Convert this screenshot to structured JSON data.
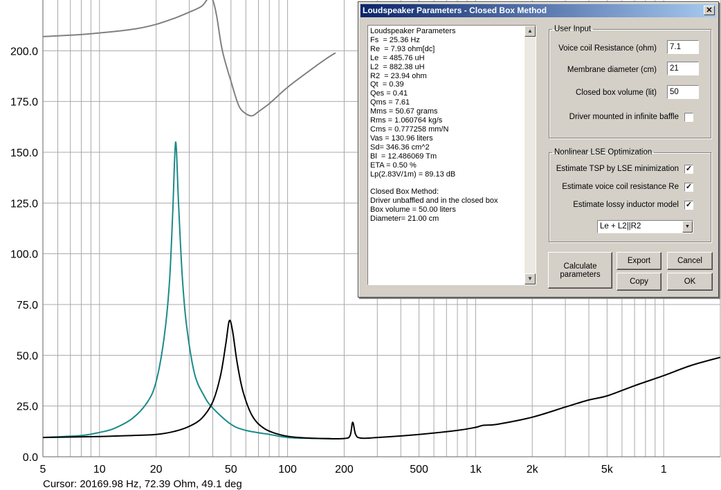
{
  "chart_data": {
    "type": "line",
    "xscale": "log",
    "xlim": [
      5,
      20000
    ],
    "ylim": [
      0,
      225
    ],
    "y_ticks": [
      "0.0",
      "25.0",
      "50.0",
      "75.0",
      "100.0",
      "125.0",
      "150.0",
      "175.0",
      "200.0"
    ],
    "y_tick_values": [
      0,
      25,
      50,
      75,
      100,
      125,
      150,
      175,
      200
    ],
    "x_ticks": [
      "5",
      "10",
      "20",
      "50",
      "100",
      "200",
      "500",
      "1k",
      "2k",
      "5k",
      "1"
    ],
    "x_tick_values": [
      5,
      10,
      20,
      50,
      100,
      200,
      500,
      1000,
      2000,
      5000,
      10000
    ],
    "grid": true,
    "series": [
      {
        "color": "#808080",
        "x": [
          5,
          8,
          12,
          16,
          20,
          25,
          30,
          35,
          38,
          40,
          42,
          45,
          50,
          55,
          60,
          65,
          70,
          80,
          100,
          130,
          160,
          180
        ],
        "y": [
          207,
          208,
          209.5,
          211,
          213,
          216,
          219,
          222,
          226,
          225,
          217,
          200,
          185,
          173,
          169,
          168,
          170,
          174,
          182,
          190,
          196,
          199
        ]
      },
      {
        "color": "#1a8a8a",
        "x": [
          5,
          8,
          10,
          12,
          15,
          18,
          20,
          22,
          23.5,
          24.5,
          25.4,
          26.3,
          27.5,
          29,
          32,
          36,
          40,
          50,
          60,
          80,
          100,
          130,
          170
        ],
        "y": [
          9.5,
          10.5,
          12,
          14,
          19,
          27,
          37,
          58,
          85,
          120,
          155,
          125,
          90,
          65,
          41,
          30,
          24,
          16,
          13,
          11,
          9.5,
          9.1,
          9.0
        ]
      },
      {
        "color": "#000000",
        "x": [
          5,
          10,
          15,
          20,
          25,
          30,
          35,
          40,
          44,
          47,
          49,
          51,
          54,
          58,
          65,
          75,
          90,
          110,
          150,
          200,
          215,
          222,
          230,
          245,
          300,
          500,
          800,
          1000,
          1100,
          1300,
          2000,
          3000,
          4000,
          5000,
          7000,
          10000,
          14000,
          20000
        ],
        "y": [
          9.5,
          10,
          10.5,
          11,
          12.5,
          15,
          19,
          27,
          40,
          56,
          67,
          62,
          46,
          32,
          20,
          14,
          11,
          9.6,
          9,
          9,
          10.5,
          17,
          11,
          9.2,
          9.5,
          11,
          13,
          14.5,
          15.5,
          16,
          19.5,
          24.5,
          28,
          30,
          35,
          40,
          45,
          49
        ]
      }
    ]
  },
  "status": {
    "cursor": "Cursor: 20169.98 Hz, 72.39 Ohm, 49.1 deg"
  },
  "dialog": {
    "title": "Loudspeaker Parameters - Closed Box Method",
    "close_glyph": "✕",
    "results": [
      "Loudspeaker Parameters",
      "Fs  = 25.36 Hz",
      "Re  = 7.93 ohm[dc]",
      "Le  = 485.76 uH",
      "L2  = 882.38 uH",
      "R2  = 23.94 ohm",
      "Qt  = 0.39",
      "Qes = 0.41",
      "Qms = 7.61",
      "Mms = 50.67 grams",
      "Rms = 1.060764 kg/s",
      "Cms = 0.777258 mm/N",
      "Vas = 130.96 liters",
      "Sd= 346.36 cm^2",
      "Bl  = 12.486069 Tm",
      "ETA = 0.50 %",
      "Lp(2.83V/1m) = 89.13 dB",
      "",
      "Closed Box Method:",
      "Driver unbaffled and in the closed box",
      "Box volume = 50.00 liters",
      "Diameter= 21.00 cm"
    ],
    "scroll_up_glyph": "▲",
    "scroll_down_glyph": "▼",
    "user_input": {
      "title": "User Input",
      "voice_coil_label": "Voice coil Resistance (ohm)",
      "voice_coil_value": "7.1",
      "diameter_label": "Membrane diameter (cm)",
      "diameter_value": "21",
      "box_volume_label": "Closed box volume (lit)",
      "box_volume_value": "50",
      "infinite_baffle_label": "Driver mounted in infinite baffle",
      "infinite_baffle_checked": ""
    },
    "lse": {
      "title": "Nonlinear LSE Optimization",
      "tsp_label": "Estimate TSP by LSE minimization",
      "tsp_check": "✓",
      "re_label": "Estimate voice coil resistance Re",
      "re_check": "✓",
      "lossy_label": "Estimate lossy inductor model",
      "lossy_check": "✓",
      "model_value": "Le + L2||R2",
      "dropdown_glyph": "▼"
    },
    "buttons": {
      "calculate": "Calculate\nparameters",
      "export": "Export",
      "cancel": "Cancel",
      "copy": "Copy",
      "ok": "OK"
    }
  }
}
